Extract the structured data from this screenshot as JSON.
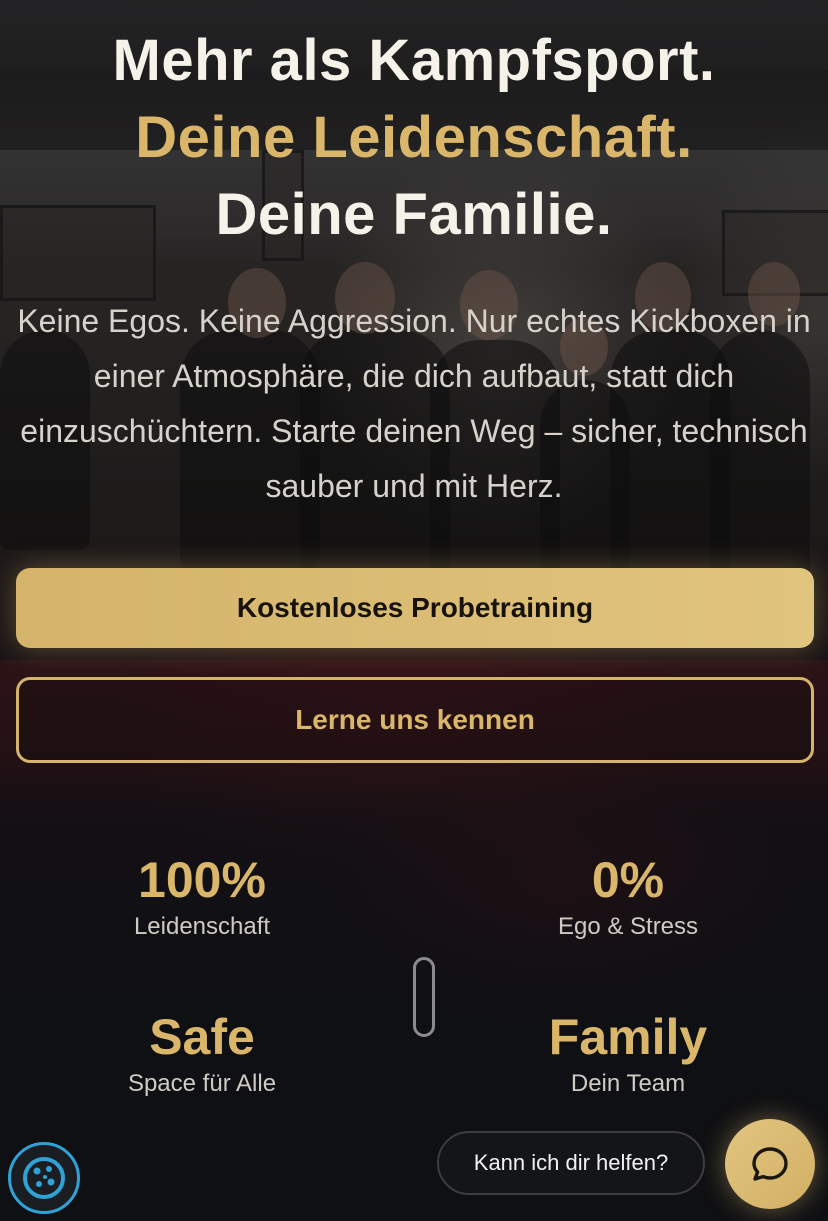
{
  "hero": {
    "title_line1": "Mehr als Kampfsport.",
    "title_line2": "Deine Leidenschaft.",
    "title_line3": "Deine Familie.",
    "text": "Keine Egos. Keine Aggression. Nur echtes Kickboxen in einer Atmosphäre, die dich aufbaut, statt dich einzuschüchtern. Starte deinen Weg – sicher, technisch sauber und mit Herz.",
    "primary_button": "Kostenloses Probetraining",
    "secondary_button": "Lerne uns kennen"
  },
  "stats": [
    {
      "value": "100%",
      "label": "Leidenschaft"
    },
    {
      "value": "0%",
      "label": "Ego & Stress"
    },
    {
      "value": "Safe",
      "label": "Space für Alle"
    },
    {
      "value": "Family",
      "label": "Dein Team"
    }
  ],
  "widgets": {
    "help_text": "Kann ich dir helfen?",
    "cookie_icon": "cookie-icon",
    "chat_icon": "chat-bubble-icon"
  },
  "colors": {
    "accent_gold": "#d9b66a",
    "background": "#0f1013",
    "cookie_blue": "#2fa3d6"
  }
}
